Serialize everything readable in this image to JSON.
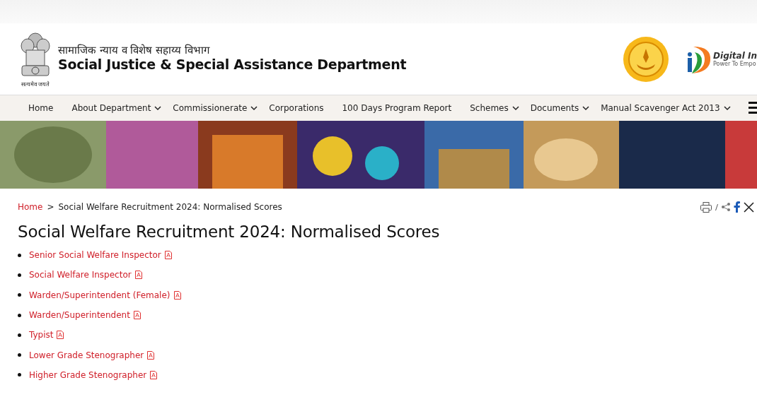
{
  "header": {
    "title_hindi": "सामाजिक न्याय व विशेष सहाय्य विभाग",
    "title": "Social Justice & Special Assistance Department",
    "emblem_motto": "सत्यमेव जयते",
    "partner_logo_title": "Digital In",
    "partner_logo_tagline": "Power To Empo"
  },
  "nav": {
    "items": [
      {
        "label": "Home",
        "has_dropdown": false
      },
      {
        "label": "About Department",
        "has_dropdown": true
      },
      {
        "label": "Commissionerate",
        "has_dropdown": true
      },
      {
        "label": "Corporations",
        "has_dropdown": false
      },
      {
        "label": "100 Days Program Report",
        "has_dropdown": false
      },
      {
        "label": "Schemes",
        "has_dropdown": true
      },
      {
        "label": "Documents",
        "has_dropdown": true
      },
      {
        "label": "Manual Scavenger Act 2013",
        "has_dropdown": true
      }
    ]
  },
  "breadcrumb": {
    "separator": ">",
    "items": [
      "Home",
      "Social Welfare Recruitment 2024: Normalised Scores"
    ]
  },
  "page_title": "Social Welfare Recruitment 2024: Normalised Scores",
  "documents": [
    {
      "label": "Senior Social Welfare Inspector"
    },
    {
      "label": "Social Welfare Inspector"
    },
    {
      "label": "Warden/Superintendent (Female)"
    },
    {
      "label": "Warden/Superintendent"
    },
    {
      "label": "Typist"
    },
    {
      "label": "Lower Grade Stenographer"
    },
    {
      "label": "Higher Grade Stenographer"
    }
  ]
}
